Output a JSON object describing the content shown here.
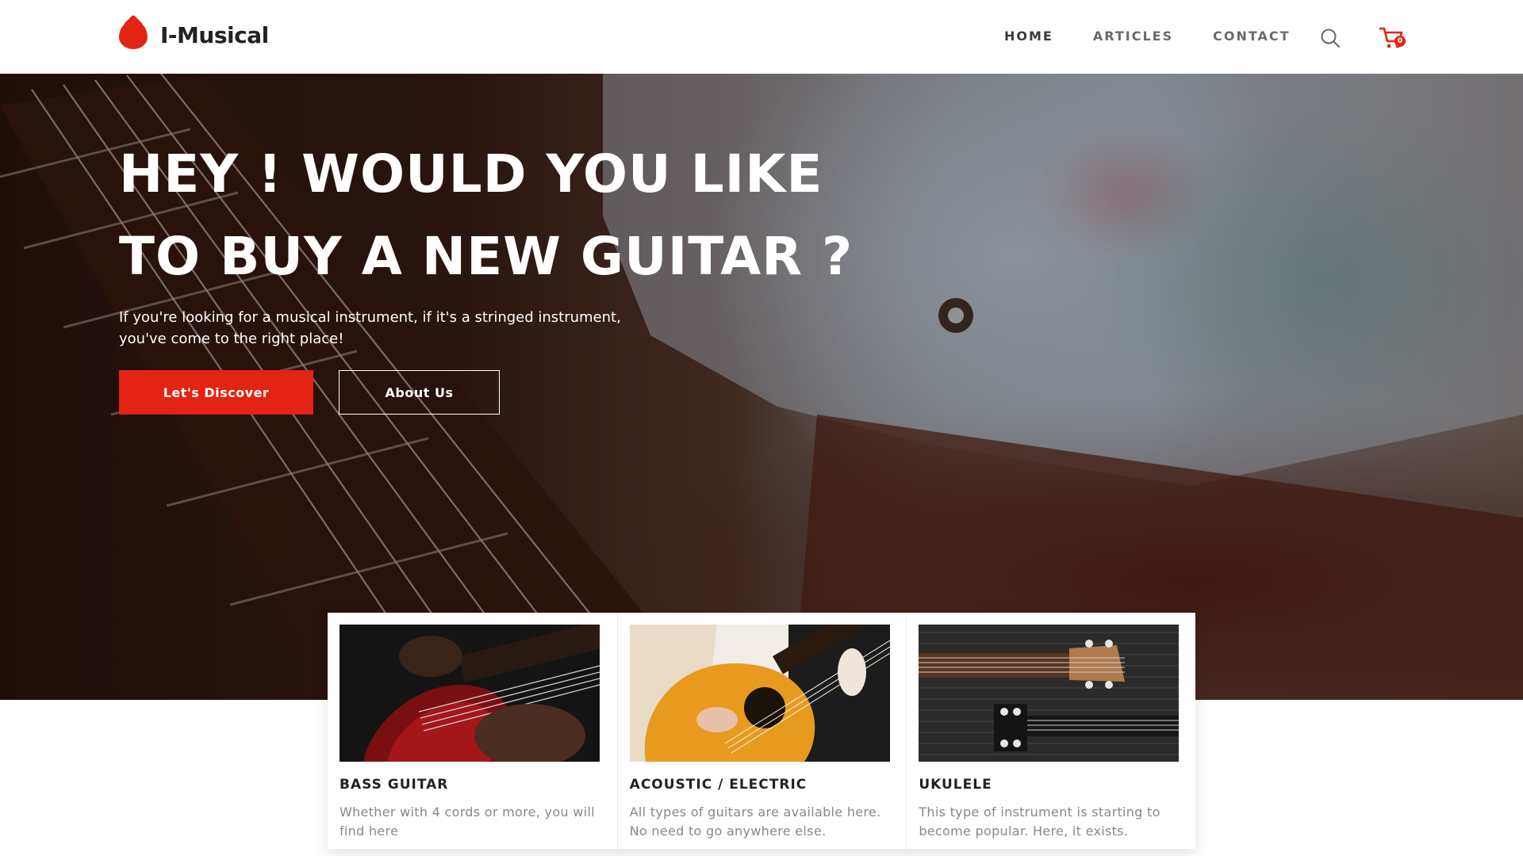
{
  "brand": {
    "name": "I-Musical",
    "accent": "#e32314"
  },
  "nav": {
    "items": [
      {
        "label": "HOME"
      },
      {
        "label": "ARTICLES"
      },
      {
        "label": "CONTACT"
      }
    ],
    "search_icon": "search-icon",
    "cart_icon": "cart-icon",
    "cart_count": "0"
  },
  "hero": {
    "title_line1": "HEY ! WOULD YOU LIKE",
    "title_line2": "TO BUY A NEW GUITAR ?",
    "subtitle": "If you're looking for a musical instrument, if it's a stringed instrument, you've come to the right place!",
    "primary_button": "Let's Discover",
    "secondary_button": "About Us"
  },
  "cards": [
    {
      "title": "BASS GUITAR",
      "text": "Whether with 4 cords or more, you will find here"
    },
    {
      "title": "ACOUSTIC / ELECTRIC",
      "text": "All types of guitars are available here. No need to go anywhere else."
    },
    {
      "title": "UKULELE",
      "text": "This type of instrument is starting to become popular. Here, it exists."
    }
  ]
}
